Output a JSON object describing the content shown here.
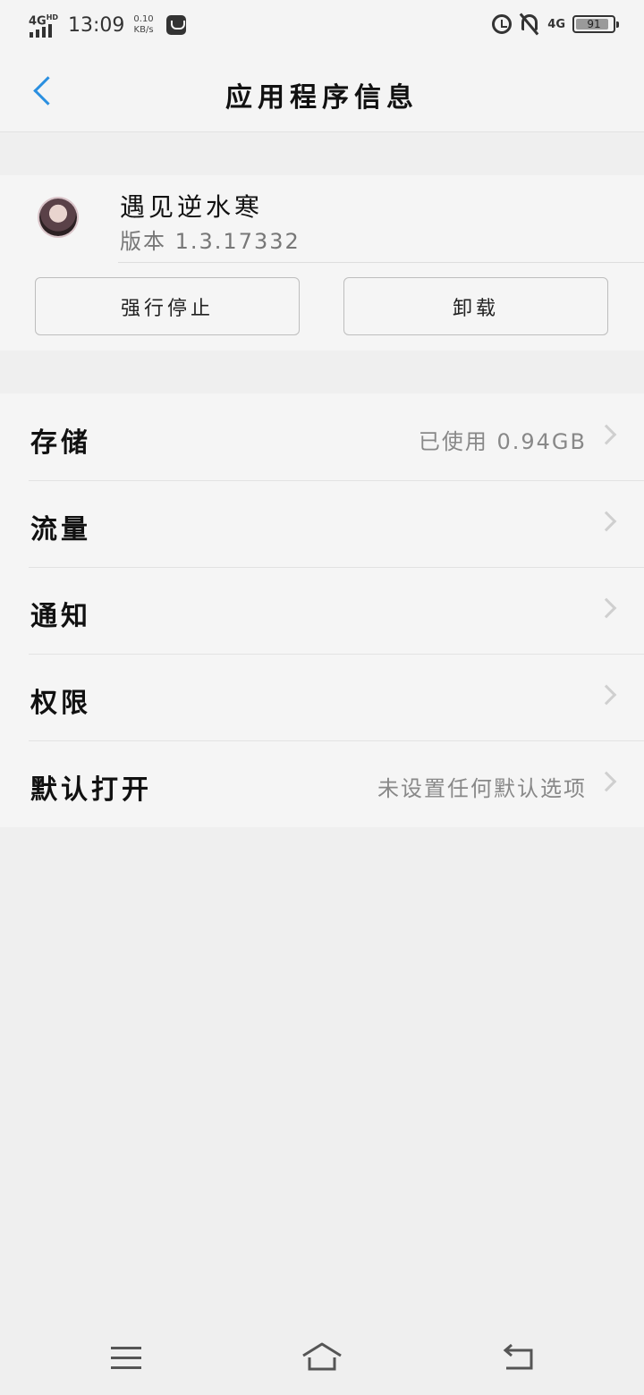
{
  "status_bar": {
    "network": "4G",
    "network_sup": "HD",
    "time": "13:09",
    "speed_value": "0.10",
    "speed_unit": "KB/s",
    "mobile_net": "4G",
    "battery": "91",
    "battery_fraction": 0.91
  },
  "header": {
    "title": "应用程序信息"
  },
  "app": {
    "name": "遇见逆水寒",
    "version": "版本 1.3.17332",
    "force_stop_label": "强行停止",
    "uninstall_label": "卸载"
  },
  "settings": {
    "rows": [
      {
        "label": "存储",
        "value": "已使用 0.94GB"
      },
      {
        "label": "流量",
        "value": ""
      },
      {
        "label": "通知",
        "value": ""
      },
      {
        "label": "权限",
        "value": ""
      },
      {
        "label": "默认打开",
        "value": "未设置任何默认选项"
      }
    ]
  },
  "colors": {
    "accent": "#2a8fe0",
    "background": "#efefef",
    "card": "#f5f5f5"
  },
  "icons": {
    "back": "chevron-left-icon",
    "menu": "menu-icon",
    "home": "home-icon",
    "nav_back": "return-icon"
  }
}
